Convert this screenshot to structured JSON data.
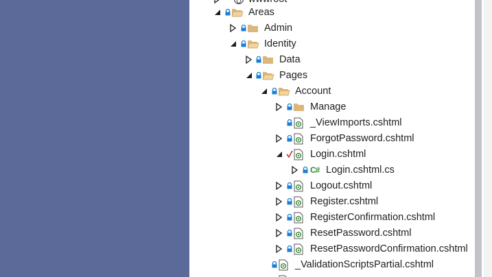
{
  "tree": {
    "partial_top_label": "wwwroot",
    "areas": "Areas",
    "admin": "Admin",
    "identity": "Identity",
    "data": "Data",
    "pages": "Pages",
    "account": "Account",
    "manage": "Manage",
    "view_imports": "_ViewImports.cshtml",
    "forgot_password": "ForgotPassword.cshtml",
    "login": "Login.cshtml",
    "login_cs_glyph": "C#",
    "login_cs": "Login.cshtml.cs",
    "logout": "Logout.cshtml",
    "register": "Register.cshtml",
    "register_confirmation": "RegisterConfirmation.cshtml",
    "reset_password": "ResetPassword.cshtml",
    "reset_password_confirmation": "ResetPasswordConfirmation.cshtml",
    "validation_scripts_partial": "_ValidationScriptsPartial.cshtml"
  },
  "colors": {
    "background": "#5c6a99",
    "panel": "#ffffff",
    "folder": "#dcb67a",
    "lock": "#1a7fd4",
    "check": "#d13438",
    "csharp": "#388a34",
    "razor": "#388a34",
    "scroll_thumb": "#c2c3c9"
  }
}
